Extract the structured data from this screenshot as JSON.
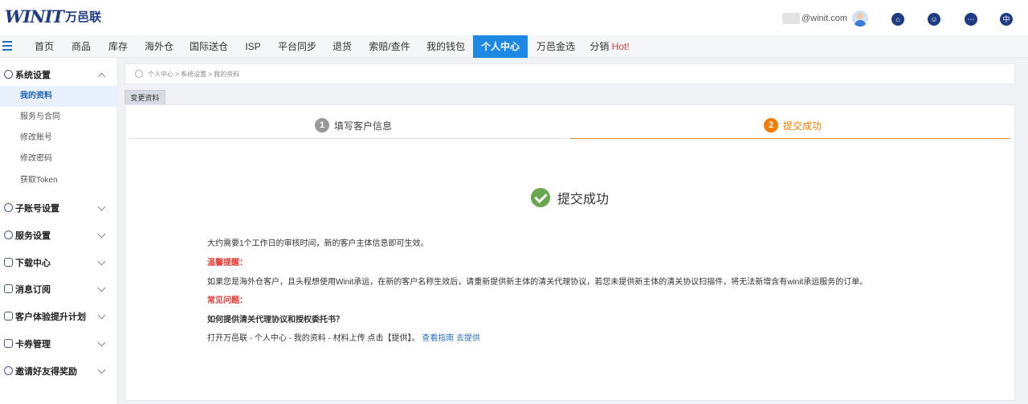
{
  "header": {
    "logo_mark": "WINIT",
    "logo_cn": "万邑联",
    "account_email": "@winit.com",
    "icons": [
      "home-icon",
      "support-icon",
      "message-icon",
      "language-icon"
    ],
    "language_glyph": "中"
  },
  "nav": {
    "items": [
      "首页",
      "商品",
      "库存",
      "海外仓",
      "国际送仓",
      "ISP",
      "平台同步",
      "退货",
      "索赔/查件",
      "我的钱包",
      "个人中心",
      "万邑金选",
      "分销"
    ],
    "hot_label": "Hot!",
    "active_index": 10,
    "accent": "#1e88e5"
  },
  "sidebar": {
    "groups": [
      {
        "label": "系统设置",
        "icon": "settings-icon",
        "expanded": true,
        "items": [
          "我的资料",
          "服务与合同",
          "修改账号",
          "修改密码",
          "获取Token"
        ],
        "active_item": 0
      },
      {
        "label": "子账号设置",
        "icon": "user-icon",
        "expanded": false
      },
      {
        "label": "服务设置",
        "icon": "heart-icon",
        "expanded": false
      },
      {
        "label": "下载中心",
        "icon": "download-icon",
        "expanded": false
      },
      {
        "label": "消息订阅",
        "icon": "bookmark-icon",
        "expanded": false
      },
      {
        "label": "客户体验提升计划",
        "icon": "list-icon",
        "expanded": false
      },
      {
        "label": "卡券管理",
        "icon": "ticket-icon",
        "expanded": false
      },
      {
        "label": "邀请好友得奖励",
        "icon": "invite-icon",
        "expanded": false
      }
    ]
  },
  "breadcrumb": "个人中心 > 系统设置 > 我的资料",
  "tab_label": "变更资料",
  "steps": [
    {
      "num": "1",
      "label": "填写客户信息",
      "state": "done",
      "color": "#999999"
    },
    {
      "num": "2",
      "label": "提交成功",
      "state": "current",
      "color": "#f57c00"
    }
  ],
  "success": {
    "title": "提交成功",
    "line1": "大约需要1个工作日的审核时间，新的客户主体信息即可生效。",
    "notice_title": "温馨提醒：",
    "notice_body": "如果您是海外仓客户，且头程想使用Winit承运，在新的客户名称生效后，请重新提供新主体的清关代理协议，若您未提供新主体的清关协议扫描件，将无法新增含有winit承运服务的订单。",
    "faq_title": "常见问题：",
    "faq_q": "如何提供清关代理协议和授权委托书？",
    "faq_a": "打开万邑联 - 个人中心 - 我的资料 - 材料上传 点击【提供】。",
    "link_guide": "查看指南",
    "link_provide": "去提供"
  }
}
